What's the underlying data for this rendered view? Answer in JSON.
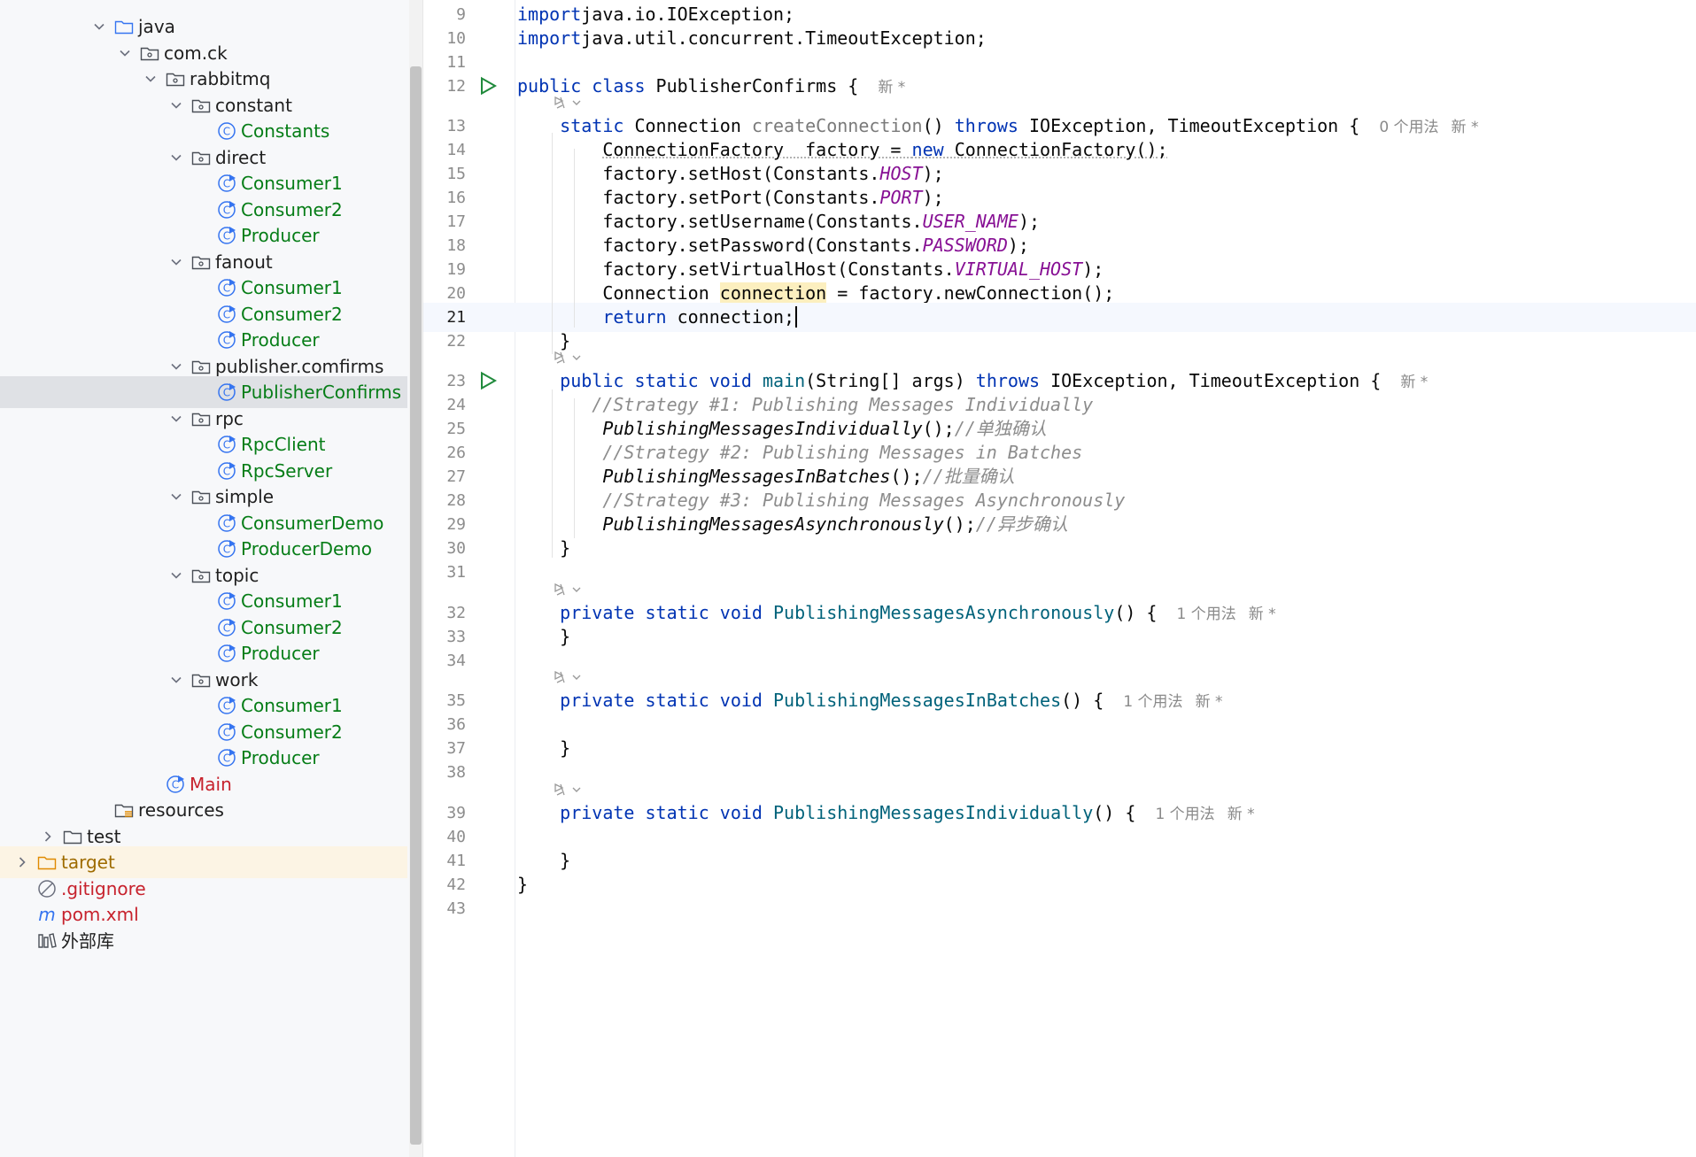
{
  "tree": {
    "rows": [
      {
        "label": "java",
        "type": "folder-src",
        "color": "dark",
        "expanded": true
      },
      {
        "label": "com.ck",
        "type": "package",
        "color": "dark",
        "expanded": true
      },
      {
        "label": "rabbitmq",
        "type": "package",
        "color": "dark",
        "expanded": true
      },
      {
        "label": "constant",
        "type": "package",
        "color": "dark",
        "expanded": true
      },
      {
        "label": "Constants",
        "type": "class",
        "color": "green"
      },
      {
        "label": "direct",
        "type": "package",
        "color": "dark",
        "expanded": true
      },
      {
        "label": "Consumer1",
        "type": "class-run",
        "color": "green"
      },
      {
        "label": "Consumer2",
        "type": "class-run",
        "color": "green"
      },
      {
        "label": "Producer",
        "type": "class-run",
        "color": "green"
      },
      {
        "label": "fanout",
        "type": "package",
        "color": "dark",
        "expanded": true
      },
      {
        "label": "Consumer1",
        "type": "class-run",
        "color": "green"
      },
      {
        "label": "Consumer2",
        "type": "class-run",
        "color": "green"
      },
      {
        "label": "Producer",
        "type": "class-run",
        "color": "green"
      },
      {
        "label": "publisher.comfirms",
        "type": "package",
        "color": "dark",
        "expanded": true
      },
      {
        "label": "PublisherConfirms",
        "type": "class-run",
        "color": "green",
        "selected": true
      },
      {
        "label": "rpc",
        "type": "package",
        "color": "dark",
        "expanded": true
      },
      {
        "label": "RpcClient",
        "type": "class-run",
        "color": "green"
      },
      {
        "label": "RpcServer",
        "type": "class-run",
        "color": "green"
      },
      {
        "label": "simple",
        "type": "package",
        "color": "dark",
        "expanded": true
      },
      {
        "label": "ConsumerDemo",
        "type": "class-run",
        "color": "green"
      },
      {
        "label": "ProducerDemo",
        "type": "class-run",
        "color": "green"
      },
      {
        "label": "topic",
        "type": "package",
        "color": "dark",
        "expanded": true
      },
      {
        "label": "Consumer1",
        "type": "class-run",
        "color": "green"
      },
      {
        "label": "Consumer2",
        "type": "class-run",
        "color": "green"
      },
      {
        "label": "Producer",
        "type": "class-run",
        "color": "green"
      },
      {
        "label": "work",
        "type": "package",
        "color": "dark",
        "expanded": true
      },
      {
        "label": "Consumer1",
        "type": "class-run",
        "color": "green"
      },
      {
        "label": "Consumer2",
        "type": "class-run",
        "color": "green"
      },
      {
        "label": "Producer",
        "type": "class-run",
        "color": "green"
      },
      {
        "label": "Main",
        "type": "class-run",
        "color": "red"
      },
      {
        "label": "resources",
        "type": "folder-res",
        "color": "dark"
      },
      {
        "label": "test",
        "type": "folder",
        "color": "dark",
        "expanded": false
      },
      {
        "label": "target",
        "type": "folder-excluded",
        "color": "olive",
        "expanded": false,
        "ignored": true
      },
      {
        "label": ".gitignore",
        "type": "ignore-file",
        "color": "red"
      },
      {
        "label": "pom.xml",
        "type": "maven",
        "color": "red"
      },
      {
        "label": "外部库",
        "type": "library",
        "color": "dark"
      }
    ]
  },
  "editor": {
    "current_line": "21",
    "lines": [
      {
        "n": "9",
        "tokens": [
          [
            "kw",
            "import"
          ],
          [
            "",
            "java.io.IOException;"
          ]
        ]
      },
      {
        "n": "10",
        "tokens": [
          [
            "kw",
            "import"
          ],
          [
            "",
            "java.util.concurrent.TimeoutException;"
          ]
        ]
      },
      {
        "n": "11",
        "tokens": []
      },
      {
        "n": "12",
        "run": true,
        "tokens": [
          [
            "kw",
            "public class "
          ],
          [
            "",
            "PublisherConfirms { "
          ],
          [
            "hint",
            "新 *"
          ]
        ]
      },
      {
        "n": "13",
        "ai": true,
        "tokens": [
          [
            "",
            "    "
          ],
          [
            "kw",
            "static "
          ],
          [
            "",
            "Connection "
          ],
          [
            "fnd",
            "createConnection"
          ],
          [
            "",
            "() "
          ],
          [
            "kw",
            "throws "
          ],
          [
            "",
            "IOException, TimeoutException { "
          ],
          [
            "hint",
            "0 个用法"
          ],
          [
            "hint2",
            "新 *"
          ]
        ]
      },
      {
        "n": "14",
        "tokens": [
          [
            "",
            "        "
          ],
          [
            "squig",
            "ConnectionFactory  factory = "
          ],
          [
            "kw squig",
            "new "
          ],
          [
            "squig",
            "ConnectionFactory();"
          ]
        ]
      },
      {
        "n": "15",
        "tokens": [
          [
            "",
            "        factory.setHost(Constants."
          ],
          [
            "const",
            "HOST"
          ],
          [
            "",
            ");"
          ]
        ]
      },
      {
        "n": "16",
        "tokens": [
          [
            "",
            "        factory.setPort(Constants."
          ],
          [
            "const",
            "PORT"
          ],
          [
            "",
            ");"
          ]
        ]
      },
      {
        "n": "17",
        "tokens": [
          [
            "",
            "        factory.setUsername(Constants."
          ],
          [
            "const",
            "USER_NAME"
          ],
          [
            "",
            ");"
          ]
        ]
      },
      {
        "n": "18",
        "tokens": [
          [
            "",
            "        factory.setPassword(Constants."
          ],
          [
            "const",
            "PASSWORD"
          ],
          [
            "",
            ");"
          ]
        ]
      },
      {
        "n": "19",
        "tokens": [
          [
            "",
            "        factory.setVirtualHost(Constants."
          ],
          [
            "const",
            "VIRTUAL_HOST"
          ],
          [
            "",
            ");"
          ]
        ]
      },
      {
        "n": "20",
        "tokens": [
          [
            "",
            "        Connection "
          ],
          [
            "hl",
            "connection"
          ],
          [
            "",
            " = factory.newConnection();"
          ]
        ]
      },
      {
        "n": "21",
        "caret": true,
        "tokens": [
          [
            "",
            "        "
          ],
          [
            "kw",
            "return "
          ],
          [
            "",
            "connection;"
          ]
        ]
      },
      {
        "n": "22",
        "tokens": [
          [
            "",
            "    }"
          ]
        ]
      },
      {
        "n": "23",
        "run": true,
        "ai": true,
        "tokens": [
          [
            "",
            "    "
          ],
          [
            "kw",
            "public static void "
          ],
          [
            "fn",
            "main"
          ],
          [
            "",
            "(String[] args) "
          ],
          [
            "kw",
            "throws "
          ],
          [
            "",
            "IOException, TimeoutException { "
          ],
          [
            "hint",
            "新 *"
          ]
        ]
      },
      {
        "n": "24",
        "tokens": [
          [
            "cmt",
            "       //Strategy #1: Publishing Messages Individually"
          ]
        ]
      },
      {
        "n": "25",
        "tokens": [
          [
            "",
            "        "
          ],
          [
            "ital",
            "PublishingMessagesIndividually"
          ],
          [
            "",
            "();"
          ],
          [
            "cmt",
            "//单独确认"
          ]
        ]
      },
      {
        "n": "26",
        "tokens": [
          [
            "cmt",
            "        //Strategy #2: Publishing Messages in Batches"
          ]
        ]
      },
      {
        "n": "27",
        "tokens": [
          [
            "",
            "        "
          ],
          [
            "ital",
            "PublishingMessagesInBatches"
          ],
          [
            "",
            "();"
          ],
          [
            "cmt",
            "//批量确认"
          ]
        ]
      },
      {
        "n": "28",
        "tokens": [
          [
            "cmt",
            "        //Strategy #3: Publishing Messages Asynchronously"
          ]
        ]
      },
      {
        "n": "29",
        "tokens": [
          [
            "",
            "        "
          ],
          [
            "ital",
            "PublishingMessagesAsynchronously"
          ],
          [
            "",
            "();"
          ],
          [
            "cmt",
            "//异步确认"
          ]
        ]
      },
      {
        "n": "30",
        "tokens": [
          [
            "",
            "    }"
          ]
        ]
      },
      {
        "n": "31",
        "tokens": []
      },
      {
        "n": "32",
        "ai": true,
        "tokens": [
          [
            "",
            "    "
          ],
          [
            "kw",
            "private static void "
          ],
          [
            "fn",
            "PublishingMessagesAsynchronously"
          ],
          [
            "",
            "() { "
          ],
          [
            "hint",
            "1 个用法"
          ],
          [
            "hint2",
            "新 *"
          ]
        ]
      },
      {
        "n": "33",
        "tokens": [
          [
            "",
            "    }"
          ]
        ]
      },
      {
        "n": "34",
        "tokens": []
      },
      {
        "n": "35",
        "ai": true,
        "tokens": [
          [
            "",
            "    "
          ],
          [
            "kw",
            "private static void "
          ],
          [
            "fn",
            "PublishingMessagesInBatches"
          ],
          [
            "",
            "() { "
          ],
          [
            "hint",
            "1 个用法"
          ],
          [
            "hint2",
            "新 *"
          ]
        ]
      },
      {
        "n": "36",
        "tokens": []
      },
      {
        "n": "37",
        "tokens": [
          [
            "",
            "    }"
          ]
        ]
      },
      {
        "n": "38",
        "tokens": []
      },
      {
        "n": "39",
        "ai": true,
        "tokens": [
          [
            "",
            "    "
          ],
          [
            "kw",
            "private static void "
          ],
          [
            "fn",
            "PublishingMessagesIndividually"
          ],
          [
            "",
            "() { "
          ],
          [
            "hint",
            "1 个用法"
          ],
          [
            "hint2",
            "新 *"
          ]
        ]
      },
      {
        "n": "40",
        "tokens": []
      },
      {
        "n": "41",
        "tokens": [
          [
            "",
            "    }"
          ]
        ]
      },
      {
        "n": "42",
        "tokens": [
          [
            "",
            "}"
          ]
        ]
      },
      {
        "n": "43",
        "tokens": []
      }
    ]
  },
  "colors": {
    "keyword": "#0033b3",
    "class_name_green": "#067d17",
    "constant": "#871094",
    "comment": "#8c8c8c",
    "selection": "#dfe1e5",
    "current_line": "#f5f8fe"
  }
}
